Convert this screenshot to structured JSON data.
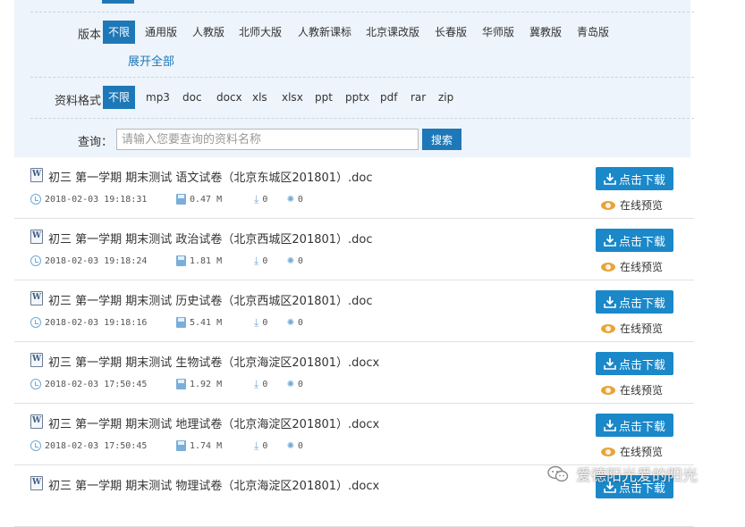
{
  "filters": {
    "version": {
      "label": "版本：",
      "options": [
        "不限",
        "通用版",
        "人教版",
        "北师大版",
        "人教新课标",
        "北京课改版",
        "长春版",
        "华师版",
        "冀教版",
        "青岛版"
      ],
      "active_index": 0,
      "expand_label": "展开全部"
    },
    "format": {
      "label": "资料格式：",
      "options": [
        "不限",
        "mp3",
        "doc",
        "docx",
        "xls",
        "xlsx",
        "ppt",
        "pptx",
        "pdf",
        "rar",
        "zip"
      ],
      "active_index": 0
    },
    "query": {
      "label": "查询：",
      "placeholder": "请输入您要查询的资料名称",
      "button_label": "搜索"
    }
  },
  "items": [
    {
      "title": "初三 第一学期 期末测试 语文试卷（北京东城区201801）.doc",
      "date": "2018-02-03 19:18:31",
      "size": "0.47 M",
      "downloads": "0",
      "views": "0"
    },
    {
      "title": "初三 第一学期 期末测试 政治试卷（北京西城区201801）.doc",
      "date": "2018-02-03 19:18:24",
      "size": "1.81 M",
      "downloads": "0",
      "views": "0"
    },
    {
      "title": "初三 第一学期 期末测试 历史试卷（北京西城区201801）.doc",
      "date": "2018-02-03 19:18:16",
      "size": "5.41 M",
      "downloads": "0",
      "views": "0"
    },
    {
      "title": "初三 第一学期 期末测试 生物试卷（北京海淀区201801）.docx",
      "date": "2018-02-03 17:50:45",
      "size": "1.92 M",
      "downloads": "0",
      "views": "0"
    },
    {
      "title": "初三 第一学期 期末测试 地理试卷（北京海淀区201801）.docx",
      "date": "2018-02-03 17:50:45",
      "size": "1.74 M",
      "downloads": "0",
      "views": "0"
    },
    {
      "title": "初三 第一学期 期末测试 物理试卷（北京海淀区201801）.docx",
      "date": "",
      "size": "",
      "downloads": "",
      "views": ""
    }
  ],
  "actions": {
    "download_label": "点击下载",
    "preview_label": "在线预览"
  },
  "watermark": {
    "text": "爱德阳光爱的阳光"
  },
  "colors": {
    "accent": "#1e78b8",
    "download_button": "#1a88c9",
    "panel_bg": "#edf4fb",
    "preview_icon": "#e8a33c"
  }
}
